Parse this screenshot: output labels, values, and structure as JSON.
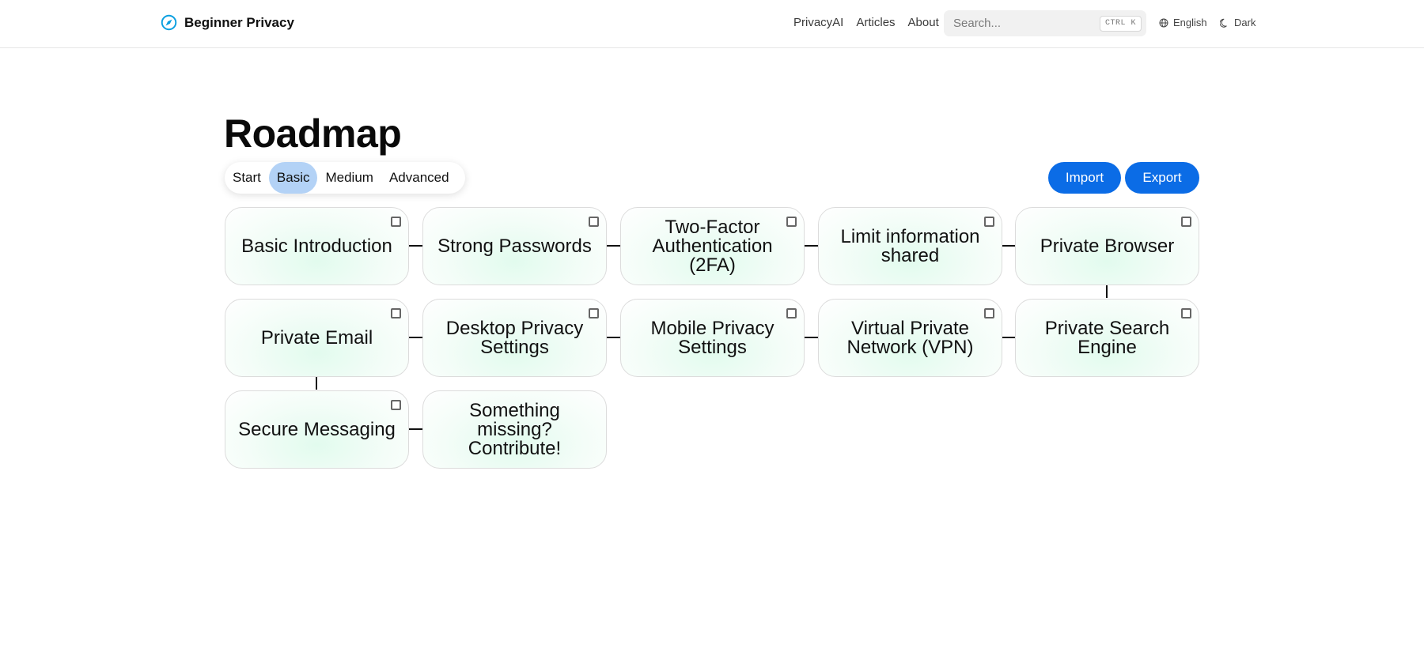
{
  "header": {
    "brand": "Beginner Privacy",
    "nav": [
      "PrivacyAI",
      "Articles",
      "About"
    ],
    "search": {
      "placeholder": "Search...",
      "shortcut": "CTRL K"
    },
    "language": "English",
    "theme": "Dark"
  },
  "main": {
    "title": "Roadmap",
    "levels": [
      "Start",
      "Basic",
      "Medium",
      "Advanced"
    ],
    "active_level": "Basic",
    "import_label": "Import",
    "export_label": "Export"
  },
  "roadmap": {
    "items": [
      {
        "label": "Basic Introduction",
        "has_checkbox": true
      },
      {
        "label": "Strong Passwords",
        "has_checkbox": true
      },
      {
        "label": "Two-Factor Authentication (2FA)",
        "has_checkbox": true
      },
      {
        "label": "Limit information shared",
        "has_checkbox": true
      },
      {
        "label": "Private Browser",
        "has_checkbox": true
      },
      {
        "label": "Private Email",
        "has_checkbox": true
      },
      {
        "label": "Desktop Privacy Settings",
        "has_checkbox": true
      },
      {
        "label": "Mobile Privacy Settings",
        "has_checkbox": true
      },
      {
        "label": "Virtual Private Network (VPN)",
        "has_checkbox": true
      },
      {
        "label": "Private Search Engine",
        "has_checkbox": true
      },
      {
        "label": "Secure Messaging",
        "has_checkbox": true
      },
      {
        "label": "Something missing? Contribute!",
        "has_checkbox": false
      }
    ]
  },
  "colors": {
    "accent": "#0b6ce6",
    "active_level": "#b3d2f6",
    "brand_icon": "#0a9fe0",
    "card_tint": "#e2fbee"
  }
}
